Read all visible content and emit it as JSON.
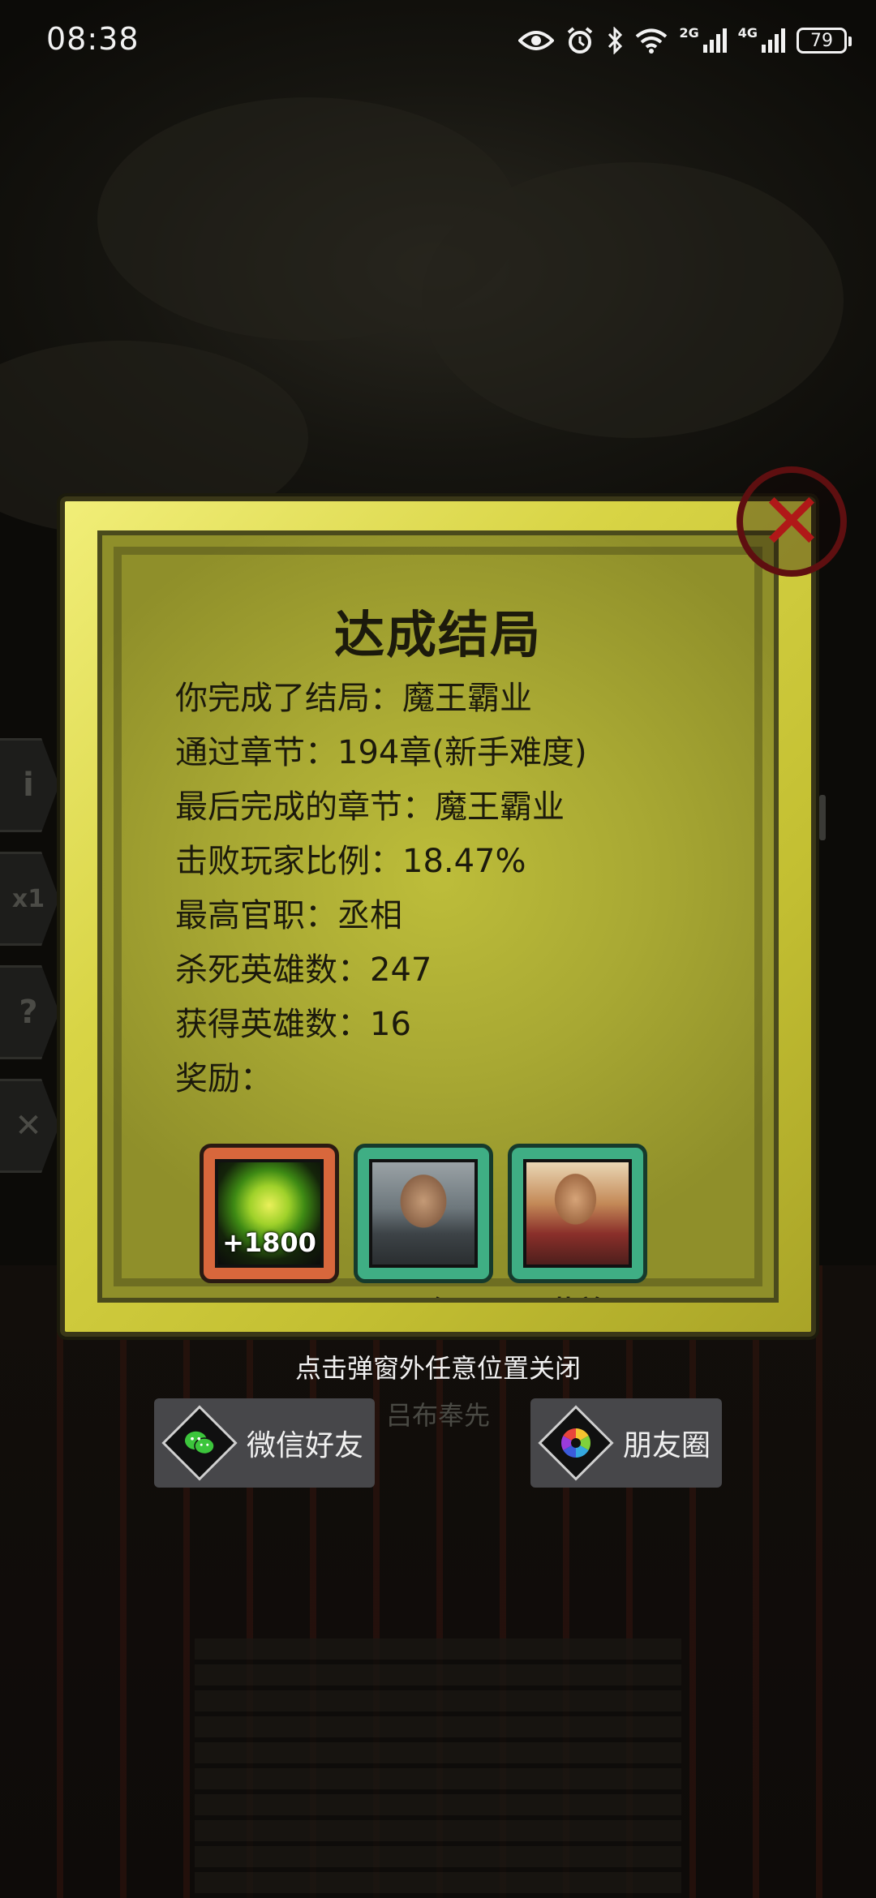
{
  "status_bar": {
    "time": "08:38",
    "signal_1_label": "2G",
    "signal_2_label": "4G",
    "battery": "79"
  },
  "popup": {
    "title": "达成结局",
    "lines": [
      "你完成了结局：魔王霸业",
      "通过章节：194章(新手难度)",
      "最后完成的章节：魔王霸业",
      "击败玩家比例：18.47%",
      "最高官职：丞相",
      "杀死英雄数：247",
      "获得英雄数：16",
      "奖励："
    ],
    "rewards": [
      {
        "icon": "gem-icon",
        "amount": "+1800",
        "caption": "玉石"
      },
      {
        "icon": "hero-portrait-icon",
        "caption": "周仓"
      },
      {
        "icon": "hero-portrait-icon",
        "caption": "黄盖"
      }
    ]
  },
  "close_hint": "点击弹窗外任意位置关闭",
  "background_name": "吕布奉先",
  "share": {
    "wechat_label": "微信好友",
    "moments_label": "朋友圈"
  },
  "colors": {
    "popup_frame": "#d8d445",
    "popup_paper": "#a8a833",
    "card_orange": "#d8673c",
    "card_green": "#3fae84",
    "close_red": "#b01818"
  }
}
